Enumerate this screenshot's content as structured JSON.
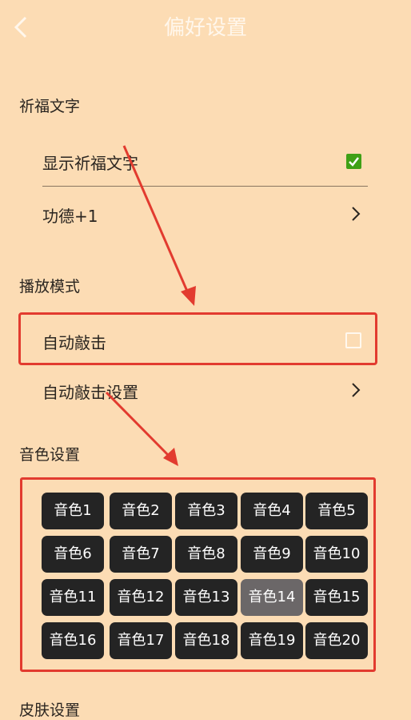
{
  "header": {
    "title": "偏好设置"
  },
  "sections": {
    "blessing": {
      "title": "祈福文字",
      "show_label": "显示祈福文字",
      "show_checked": true,
      "merit_label": "功德+1"
    },
    "playback": {
      "title": "播放模式",
      "auto_label": "自动敲击",
      "auto_checked": false,
      "auto_settings_label": "自动敲击设置"
    },
    "tone": {
      "title": "音色设置",
      "selected": "音色14",
      "items": [
        "音色1",
        "音色2",
        "音色3",
        "音色4",
        "音色5",
        "音色6",
        "音色7",
        "音色8",
        "音色9",
        "音色10",
        "音色11",
        "音色12",
        "音色13",
        "音色14",
        "音色15",
        "音色16",
        "音色17",
        "音色18",
        "音色19",
        "音色20"
      ]
    },
    "skin": {
      "title": "皮肤设置"
    }
  },
  "icons": {
    "back": "chevron-left-icon",
    "checked": "checkbox-checked-icon",
    "unchecked": "checkbox-unchecked-icon",
    "forward": "chevron-right-icon"
  },
  "colors": {
    "background": "#fcdcb4",
    "tone_button": "#242424",
    "tone_button_selected": "#6b6768",
    "checkbox_checked": "#3fa016",
    "annotation": "#e23b2f"
  }
}
